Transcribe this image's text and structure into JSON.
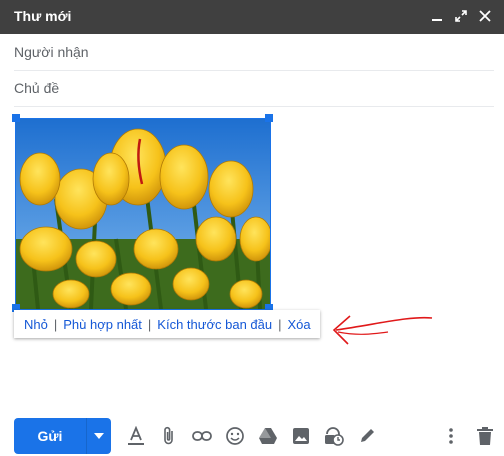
{
  "window": {
    "title": "Thư mới"
  },
  "fields": {
    "to_placeholder": "Người nhận",
    "subject_placeholder": "Chủ đề"
  },
  "image_toolbar": {
    "small": "Nhỏ",
    "best_fit": "Phù hợp nhất",
    "original_size": "Kích thước ban đầu",
    "remove": "Xóa"
  },
  "bottom": {
    "send_label": "Gửi"
  },
  "colors": {
    "accent": "#1a73e8",
    "titlebar": "#404040",
    "annotation_arrow": "#e0191a"
  },
  "icons": [
    "minimize-icon",
    "expand-icon",
    "close-icon",
    "text-format-icon",
    "attach-icon",
    "link-icon",
    "emoji-icon",
    "drive-icon",
    "photo-icon",
    "confidential-icon",
    "signature-icon",
    "more-icon",
    "trash-icon"
  ]
}
